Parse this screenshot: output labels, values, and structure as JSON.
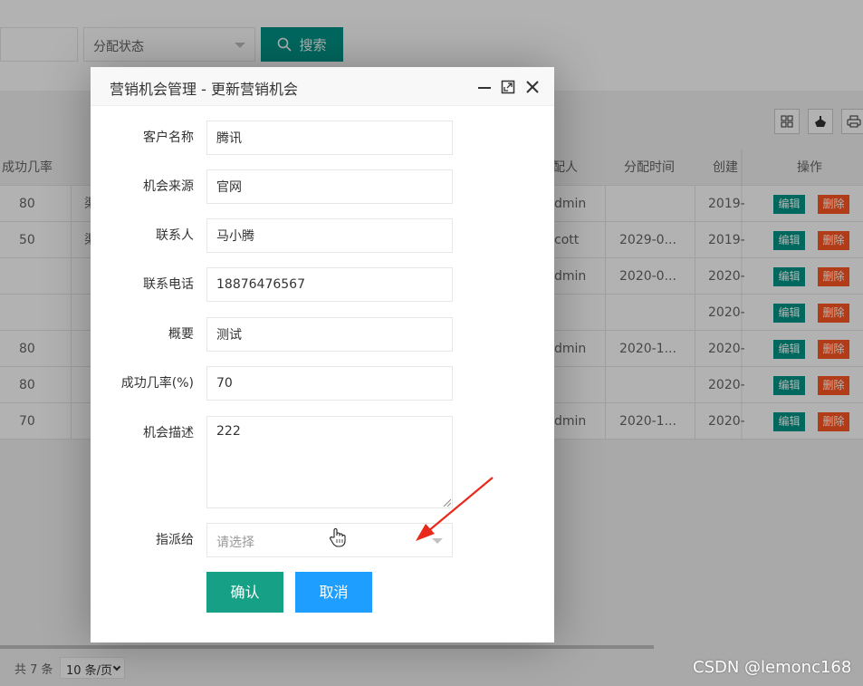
{
  "search": {
    "status_placeholder": "分配状态",
    "search_label": "搜索"
  },
  "table": {
    "headers": {
      "success_rate": "成功几率",
      "assignee": "配人",
      "assign_time": "分配时间",
      "create_time": "创建",
      "actions": "操作"
    },
    "rows": [
      {
        "rate": "80",
        "source_frag": "渠",
        "assignee": "dmin",
        "assign_time": "",
        "create_time": "2019-"
      },
      {
        "rate": "50",
        "source_frag": "渠",
        "assignee": "cott",
        "assign_time": "2029-0...",
        "create_time": "2019-"
      },
      {
        "rate": "",
        "source_frag": "",
        "assignee": "dmin",
        "assign_time": "2020-0...",
        "create_time": "2020-"
      },
      {
        "rate": "",
        "source_frag": "",
        "assignee": "",
        "assign_time": "",
        "create_time": "2020-"
      },
      {
        "rate": "80",
        "source_frag": "",
        "assignee": "dmin",
        "assign_time": "2020-1...",
        "create_time": "2020-"
      },
      {
        "rate": "80",
        "source_frag": "",
        "assignee": "",
        "assign_time": "",
        "create_time": "2020-"
      },
      {
        "rate": "70",
        "source_frag": "",
        "assignee": "dmin",
        "assign_time": "2020-1...",
        "create_time": "2020-"
      }
    ],
    "edit_label": "编辑",
    "delete_label": "删除"
  },
  "pager": {
    "total": "共 7 条",
    "page_size": "10 条/页"
  },
  "modal": {
    "title": "营销机会管理 - 更新营销机会",
    "fields": {
      "customer_name": {
        "label": "客户名称",
        "value": "腾讯"
      },
      "source": {
        "label": "机会来源",
        "value": "官网"
      },
      "contact": {
        "label": "联系人",
        "value": "马小腾"
      },
      "phone": {
        "label": "联系电话",
        "value": "18876476567"
      },
      "summary": {
        "label": "概要",
        "value": "测试"
      },
      "success_rate": {
        "label": "成功几率(%)",
        "value": "70"
      },
      "description": {
        "label": "机会描述",
        "value": "222"
      },
      "assign_to": {
        "label": "指派给",
        "placeholder": "请选择"
      }
    },
    "confirm_label": "确认",
    "cancel_label": "取消"
  },
  "watermark": "CSDN @lemonc168",
  "colors": {
    "primary": "#009688",
    "danger": "#ff5722",
    "blue": "#1e9fff",
    "annotation_arrow": "#e8291c"
  }
}
